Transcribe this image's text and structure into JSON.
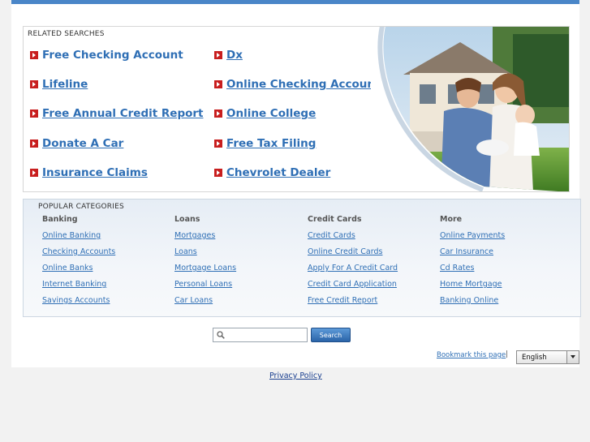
{
  "related_searches": {
    "heading": "RELATED SEARCHES",
    "links": [
      "Free Checking Account",
      "Lifeline",
      "Free Annual Credit Report",
      "Donate A Car",
      "Insurance Claims",
      "Dx",
      "Online Checking Account",
      "Online College",
      "Free Tax Filing",
      "Chevrolet Dealer"
    ]
  },
  "popular_categories": {
    "heading": "POPULAR CATEGORIES",
    "columns": [
      {
        "title": "Banking",
        "links": [
          "Online Banking",
          "Checking Accounts",
          "Online Banks",
          "Internet Banking",
          "Savings Accounts"
        ]
      },
      {
        "title": "Loans",
        "links": [
          "Mortgages",
          "Loans",
          "Mortgage Loans",
          "Personal Loans",
          "Car Loans"
        ]
      },
      {
        "title": "Credit Cards",
        "links": [
          "Credit Cards",
          "Online Credit Cards",
          "Apply For A Credit Card",
          "Credit Card Application",
          "Free Credit Report"
        ]
      },
      {
        "title": "More",
        "links": [
          "Online Payments",
          "Car Insurance",
          "Cd Rates",
          "Home Mortgage",
          "Banking Online"
        ]
      }
    ]
  },
  "search": {
    "button_label": "Search",
    "value": ""
  },
  "footer": {
    "bookmark_label": "Bookmark this page",
    "separator": "|",
    "language_selected": "English",
    "privacy_label": "Privacy Policy"
  },
  "colors": {
    "top_bar": "#4a86c8",
    "link": "#2f6fb5",
    "bullet": "#c81e1e"
  },
  "icons": {
    "bullet": "red-arrow-bullet-icon",
    "search": "magnifier-icon",
    "dropdown": "chevron-down-icon"
  }
}
